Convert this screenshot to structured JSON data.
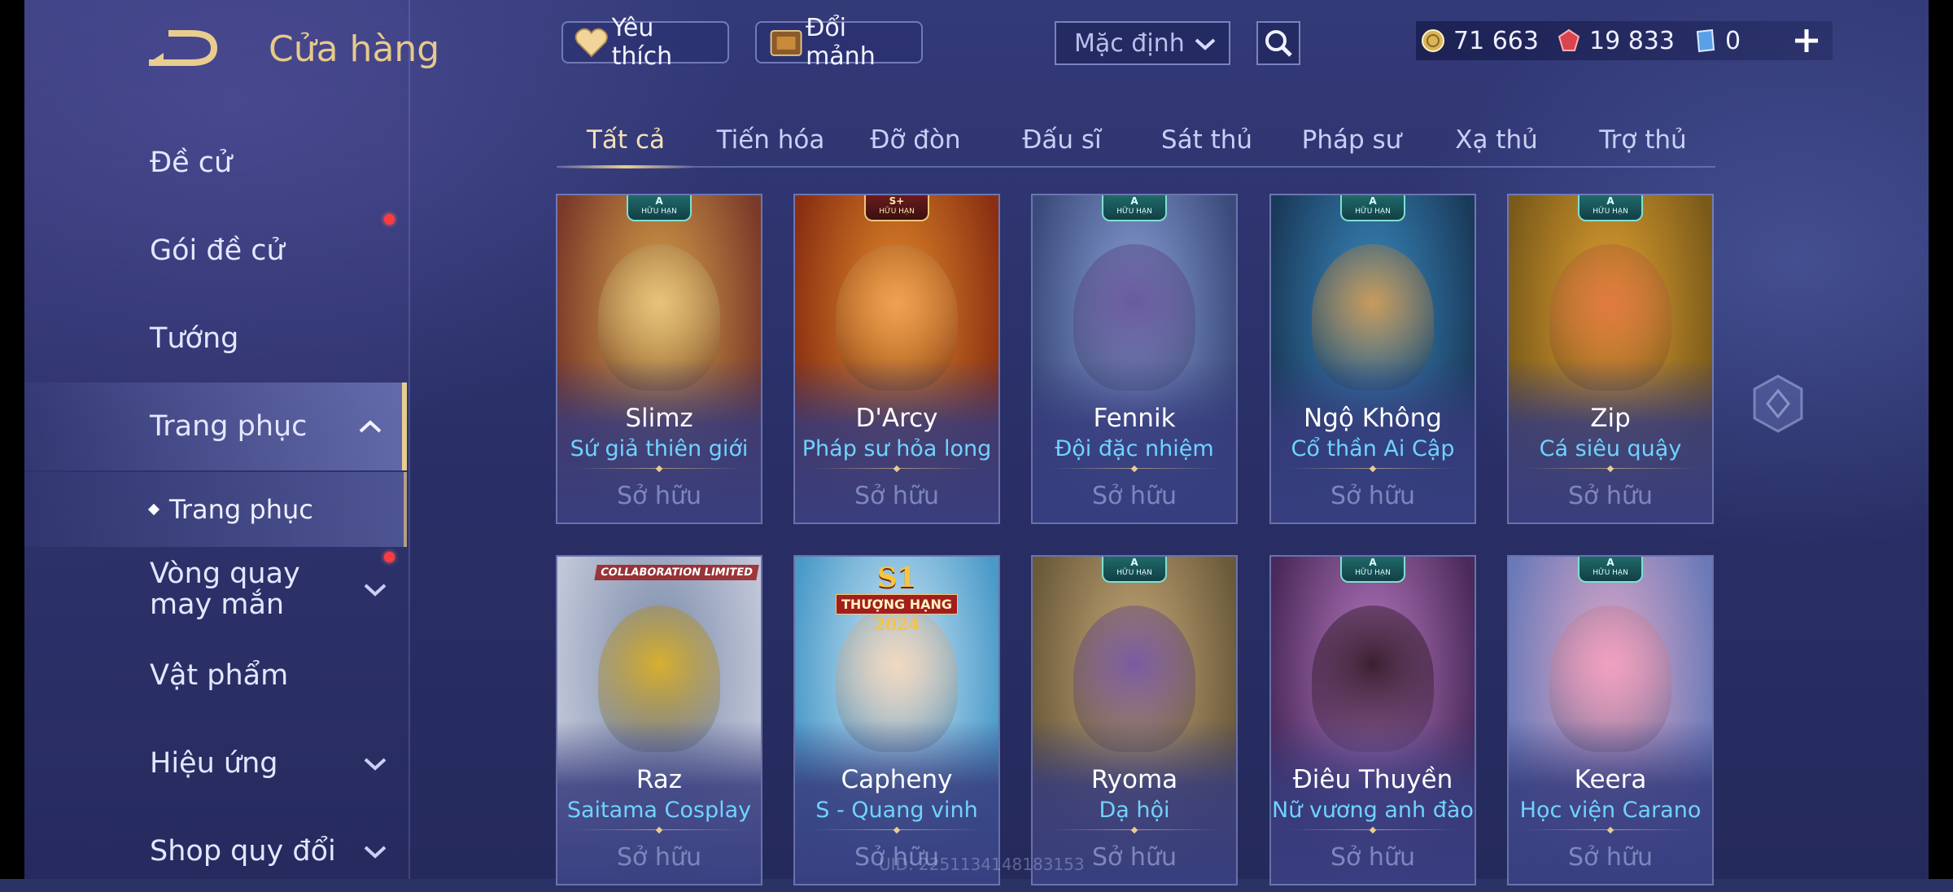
{
  "header": {
    "title": "Cửa hàng"
  },
  "sidebar": {
    "items": [
      {
        "label": "Đề cử"
      },
      {
        "label": "Gói đề cử"
      },
      {
        "label": "Tướng"
      },
      {
        "label": "Trang phục"
      },
      {
        "label": "Vòng quay may mắn"
      },
      {
        "label": "Vật phẩm"
      },
      {
        "label": "Hiệu ứng"
      },
      {
        "label": "Shop quy đổi"
      }
    ],
    "sub_items": [
      {
        "label": "Trang phục"
      }
    ]
  },
  "topbar": {
    "favorite_label": "Yêu thích",
    "exchange_label": "Đổi mảnh",
    "sort_value": "Mặc định",
    "currencies": [
      {
        "icon": "gold-coin-icon",
        "value": "71 663"
      },
      {
        "icon": "ruby-icon",
        "value": "19 833"
      },
      {
        "icon": "voucher-icon",
        "value": "0"
      }
    ]
  },
  "tabs": [
    "Tất cả",
    "Tiến hóa",
    "Đỡ đòn",
    "Đấu sĩ",
    "Sát thủ",
    "Pháp sư",
    "Xạ thủ",
    "Trợ thủ"
  ],
  "cards": [
    {
      "hero": "Slimz",
      "skin": "Sứ giả thiên giới",
      "status": "Sở hữu",
      "badge_tier": "A",
      "badge_text": "HỮU HẠN",
      "c1": "#7a3a2a",
      "c2": "#d8a24a",
      "fig": "#e6c27a"
    },
    {
      "hero": "D'Arcy",
      "skin": "Pháp sư hỏa long",
      "status": "Sở hữu",
      "badge_tier": "S+",
      "badge_text": "HỮU HẠN",
      "c1": "#8a3012",
      "c2": "#e38a2a",
      "fig": "#f0a050"
    },
    {
      "hero": "Fennik",
      "skin": "Đội đặc nhiệm",
      "status": "Sở hữu",
      "badge_tier": "A",
      "badge_text": "HỮU HẠN",
      "c1": "#3a4a7a",
      "c2": "#8aa0d8",
      "fig": "#6a5aa0"
    },
    {
      "hero": "Ngộ Không",
      "skin": "Cổ thần Ai Cập",
      "status": "Sở hữu",
      "badge_tier": "A",
      "badge_text": "HỮU HẠN",
      "c1": "#1a3a5a",
      "c2": "#3a8ac0",
      "fig": "#c89a5a"
    },
    {
      "hero": "Zip",
      "skin": "Cá siêu quậy",
      "status": "Sở hữu",
      "badge_tier": "A",
      "badge_text": "HỮU HẠN",
      "c1": "#7a5a1a",
      "c2": "#e0a030",
      "fig": "#e07a40"
    },
    {
      "hero": "Raz",
      "skin": "Saitama Cosplay",
      "status": "Sở hữu",
      "badge_text": "COLLABORATION LIMITED",
      "c1": "#c0c6d8",
      "c2": "#7a8aa8",
      "fig": "#d8b030"
    },
    {
      "hero": "Capheny",
      "skin": "S - Quang vinh",
      "status": "Sở hữu",
      "ribbon_big": "S1",
      "ribbon_mid": "THƯỢNG HẠNG",
      "ribbon_year": "2024",
      "c1": "#4a9ac8",
      "c2": "#cfe8f8",
      "fig": "#f0d8c0"
    },
    {
      "hero": "Ryoma",
      "skin": "Dạ hội",
      "status": "Sở hữu",
      "badge_tier": "A",
      "badge_text": "HỮU HẠN",
      "c1": "#6a5a3a",
      "c2": "#c8a878",
      "fig": "#7a5aa0"
    },
    {
      "hero": "Điêu Thuyền",
      "skin": "Nữ vương anh đào",
      "status": "Sở hữu",
      "badge_tier": "A",
      "badge_text": "HỮU HẠN",
      "c1": "#4a2a5a",
      "c2": "#b878c0",
      "fig": "#3a2030"
    },
    {
      "hero": "Keera",
      "skin": "Học viện Carano",
      "status": "Sở hữu",
      "badge_tier": "A",
      "badge_text": "HỮU HẠN",
      "c1": "#6a7ab8",
      "c2": "#e0a8c8",
      "fig": "#f0a0c0"
    }
  ],
  "watermark": "UID: 2251134148183153"
}
